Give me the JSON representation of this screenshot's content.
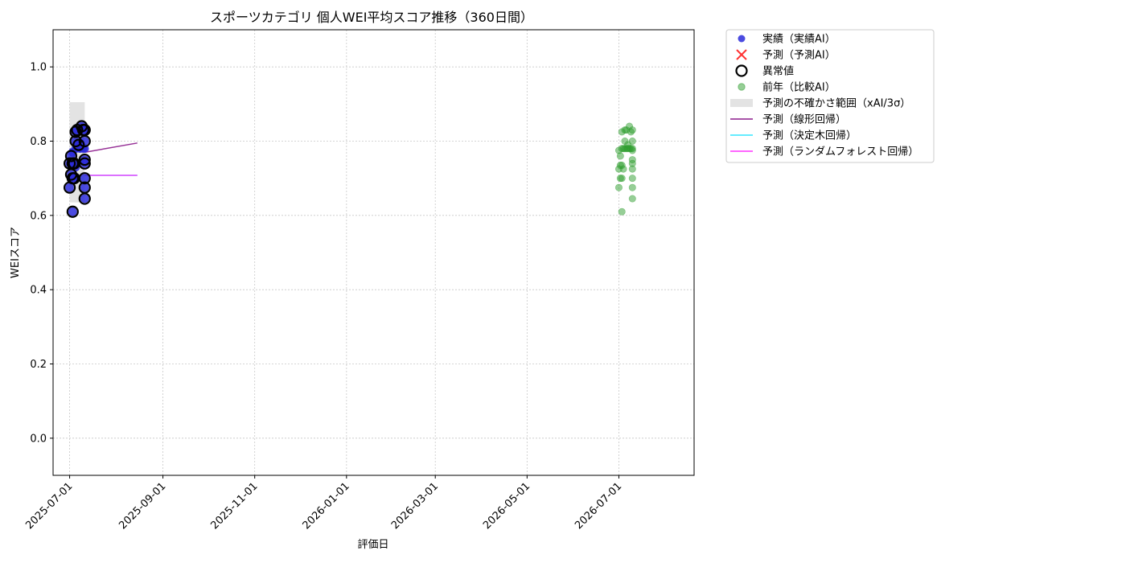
{
  "chart_data": {
    "type": "scatter",
    "title": "スポーツカテゴリ 個人WEI平均スコア推移（360日間）",
    "xlabel": "評価日",
    "ylabel": "WEIスコア",
    "ylim": [
      -0.1,
      1.1
    ],
    "xlim": [
      "2025-06-20",
      "2026-08-20"
    ],
    "yticks": [
      0.0,
      0.2,
      0.4,
      0.6,
      0.8,
      1.0
    ],
    "ytick_labels": [
      "0.0",
      "0.2",
      "0.4",
      "0.6",
      "0.8",
      "1.0"
    ],
    "xticks": [
      "2025-07-01",
      "2025-09-01",
      "2025-11-01",
      "2026-01-01",
      "2026-03-01",
      "2026-05-01",
      "2026-07-01"
    ],
    "grid": true,
    "legend_position": "outside upper-right",
    "series": [
      {
        "name": "実績（実績AI）",
        "kind": "scatter",
        "color": "#2b2bdb",
        "points": [
          {
            "x": "2025-07-01",
            "y": 0.675
          },
          {
            "x": "2025-07-01",
            "y": 0.74
          },
          {
            "x": "2025-07-02",
            "y": 0.71
          },
          {
            "x": "2025-07-02",
            "y": 0.76
          },
          {
            "x": "2025-07-03",
            "y": 0.77
          },
          {
            "x": "2025-07-03",
            "y": 0.7
          },
          {
            "x": "2025-07-03",
            "y": 0.74
          },
          {
            "x": "2025-07-03",
            "y": 0.61
          },
          {
            "x": "2025-07-04",
            "y": 0.74
          },
          {
            "x": "2025-07-04",
            "y": 0.7
          },
          {
            "x": "2025-07-05",
            "y": 0.78
          },
          {
            "x": "2025-07-05",
            "y": 0.825
          },
          {
            "x": "2025-07-05",
            "y": 0.73
          },
          {
            "x": "2025-07-05",
            "y": 0.8
          },
          {
            "x": "2025-07-06",
            "y": 0.83
          },
          {
            "x": "2025-07-07",
            "y": 0.79
          },
          {
            "x": "2025-07-08",
            "y": 0.78
          },
          {
            "x": "2025-07-08",
            "y": 0.795
          },
          {
            "x": "2025-07-09",
            "y": 0.84
          },
          {
            "x": "2025-07-10",
            "y": 0.78
          },
          {
            "x": "2025-07-10",
            "y": 0.83
          },
          {
            "x": "2025-07-11",
            "y": 0.83
          },
          {
            "x": "2025-07-11",
            "y": 0.8
          },
          {
            "x": "2025-07-11",
            "y": 0.75
          },
          {
            "x": "2025-07-11",
            "y": 0.74
          },
          {
            "x": "2025-07-11",
            "y": 0.7
          },
          {
            "x": "2025-07-11",
            "y": 0.675
          },
          {
            "x": "2025-07-11",
            "y": 0.645
          },
          {
            "x": "2025-07-11",
            "y": 0.78
          }
        ]
      },
      {
        "name": "予測（予測AI）",
        "kind": "scatter",
        "color": "#ff3333",
        "points": []
      },
      {
        "name": "異常値",
        "kind": "outline",
        "color": "#000000",
        "points": [
          {
            "x": "2025-07-01",
            "y": 0.675
          },
          {
            "x": "2025-07-01",
            "y": 0.74
          },
          {
            "x": "2025-07-02",
            "y": 0.71
          },
          {
            "x": "2025-07-02",
            "y": 0.76
          },
          {
            "x": "2025-07-03",
            "y": 0.7
          },
          {
            "x": "2025-07-03",
            "y": 0.74
          },
          {
            "x": "2025-07-03",
            "y": 0.61
          },
          {
            "x": "2025-07-04",
            "y": 0.74
          },
          {
            "x": "2025-07-04",
            "y": 0.7
          },
          {
            "x": "2025-07-05",
            "y": 0.825
          },
          {
            "x": "2025-07-05",
            "y": 0.8
          },
          {
            "x": "2025-07-06",
            "y": 0.83
          },
          {
            "x": "2025-07-07",
            "y": 0.79
          },
          {
            "x": "2025-07-09",
            "y": 0.84
          },
          {
            "x": "2025-07-10",
            "y": 0.83
          },
          {
            "x": "2025-07-11",
            "y": 0.83
          },
          {
            "x": "2025-07-11",
            "y": 0.8
          },
          {
            "x": "2025-07-11",
            "y": 0.75
          },
          {
            "x": "2025-07-11",
            "y": 0.74
          },
          {
            "x": "2025-07-11",
            "y": 0.7
          },
          {
            "x": "2025-07-11",
            "y": 0.675
          },
          {
            "x": "2025-07-11",
            "y": 0.645
          }
        ]
      },
      {
        "name": "前年（比較AI）",
        "kind": "scatter",
        "color": "#2e9e2e",
        "points": [
          {
            "x": "2026-07-01",
            "y": 0.675
          },
          {
            "x": "2026-07-01",
            "y": 0.725
          },
          {
            "x": "2026-07-01",
            "y": 0.775
          },
          {
            "x": "2026-07-02",
            "y": 0.735
          },
          {
            "x": "2026-07-02",
            "y": 0.7
          },
          {
            "x": "2026-07-02",
            "y": 0.76
          },
          {
            "x": "2026-07-03",
            "y": 0.61
          },
          {
            "x": "2026-07-03",
            "y": 0.735
          },
          {
            "x": "2026-07-03",
            "y": 0.7
          },
          {
            "x": "2026-07-03",
            "y": 0.78
          },
          {
            "x": "2026-07-03",
            "y": 0.825
          },
          {
            "x": "2026-07-04",
            "y": 0.725
          },
          {
            "x": "2026-07-04",
            "y": 0.78
          },
          {
            "x": "2026-07-05",
            "y": 0.8
          },
          {
            "x": "2026-07-05",
            "y": 0.83
          },
          {
            "x": "2026-07-05",
            "y": 0.78
          },
          {
            "x": "2026-07-06",
            "y": 0.83
          },
          {
            "x": "2026-07-06",
            "y": 0.78
          },
          {
            "x": "2026-07-07",
            "y": 0.79
          },
          {
            "x": "2026-07-07",
            "y": 0.78
          },
          {
            "x": "2026-07-08",
            "y": 0.84
          },
          {
            "x": "2026-07-08",
            "y": 0.78
          },
          {
            "x": "2026-07-09",
            "y": 0.78
          },
          {
            "x": "2026-07-09",
            "y": 0.825
          },
          {
            "x": "2026-07-10",
            "y": 0.83
          },
          {
            "x": "2026-07-10",
            "y": 0.78
          },
          {
            "x": "2026-07-10",
            "y": 0.8
          },
          {
            "x": "2026-07-10",
            "y": 0.75
          },
          {
            "x": "2026-07-10",
            "y": 0.74
          },
          {
            "x": "2026-07-10",
            "y": 0.725
          },
          {
            "x": "2026-07-10",
            "y": 0.7
          },
          {
            "x": "2026-07-10",
            "y": 0.675
          },
          {
            "x": "2026-07-10",
            "y": 0.645
          },
          {
            "x": "2026-07-10",
            "y": 0.775
          }
        ]
      },
      {
        "name": "予測の不確かさ範囲（xAI/3σ）",
        "kind": "band",
        "color": "#d9d9d9",
        "x_range": [
          "2025-07-01",
          "2025-07-11"
        ],
        "y_range": [
          0.635,
          0.905
        ]
      },
      {
        "name": "予測（線形回帰）",
        "kind": "line",
        "color": "#8b1a8b",
        "points": [
          {
            "x": "2025-07-11",
            "y": 0.77
          },
          {
            "x": "2025-08-15",
            "y": 0.795
          }
        ]
      },
      {
        "name": "予測（決定木回帰）",
        "kind": "line",
        "color": "#33e6ff",
        "points": [
          {
            "x": "2025-07-11",
            "y": 0.708
          },
          {
            "x": "2025-08-15",
            "y": 0.708
          }
        ]
      },
      {
        "name": "予測（ランダムフォレスト回帰）",
        "kind": "line",
        "color": "#ff33ff",
        "points": [
          {
            "x": "2025-07-11",
            "y": 0.708
          },
          {
            "x": "2025-08-15",
            "y": 0.708
          }
        ]
      }
    ],
    "actual_line": {
      "color": "#2b2bdb",
      "points": [
        {
          "x": "2025-07-01",
          "y": 0.775
        },
        {
          "x": "2025-07-11",
          "y": 0.775
        }
      ]
    }
  }
}
